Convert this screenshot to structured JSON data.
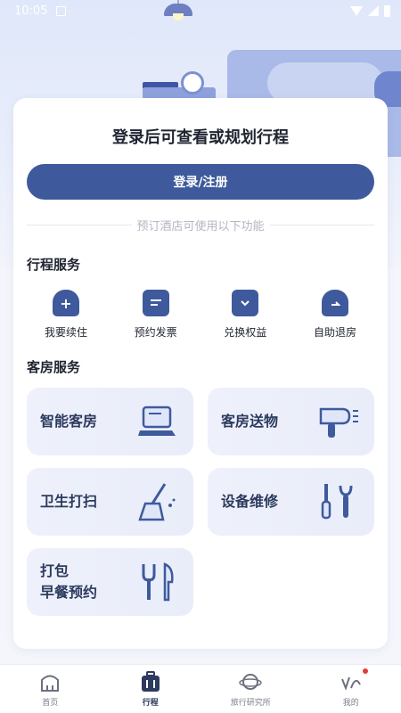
{
  "status_bar": {
    "time": "10:05"
  },
  "card": {
    "title": "登录后可查看或规划行程",
    "login_button": "登录/注册",
    "divider_text": "预订酒店可使用以下功能"
  },
  "trip_services": {
    "title": "行程服务",
    "items": [
      {
        "label": "我要续住",
        "icon": "plus-icon"
      },
      {
        "label": "预约发票",
        "icon": "invoice-icon"
      },
      {
        "label": "兑换权益",
        "icon": "ticket-icon"
      },
      {
        "label": "自助退房",
        "icon": "checkout-icon"
      }
    ]
  },
  "room_services": {
    "title": "客房服务",
    "items": [
      {
        "label": "智能客房",
        "icon": "tablet-icon"
      },
      {
        "label": "客房送物",
        "icon": "hairdryer-icon"
      },
      {
        "label": "卫生打扫",
        "icon": "broom-icon"
      },
      {
        "label": "设备维修",
        "icon": "tools-icon"
      },
      {
        "label_line1": "打包",
        "label_line2": "早餐预约",
        "icon": "cutlery-icon"
      }
    ]
  },
  "bottom_nav": {
    "items": [
      {
        "label": "首页",
        "icon": "home-icon"
      },
      {
        "label": "行程",
        "icon": "luggage-icon",
        "active": true
      },
      {
        "label": "旅行研究所",
        "icon": "planet-icon"
      },
      {
        "label": "我的",
        "icon": "profile-icon",
        "badge": true
      }
    ]
  },
  "colors": {
    "primary": "#3f5a9c",
    "background": "#f4f6fb",
    "badge": "#e53935"
  }
}
